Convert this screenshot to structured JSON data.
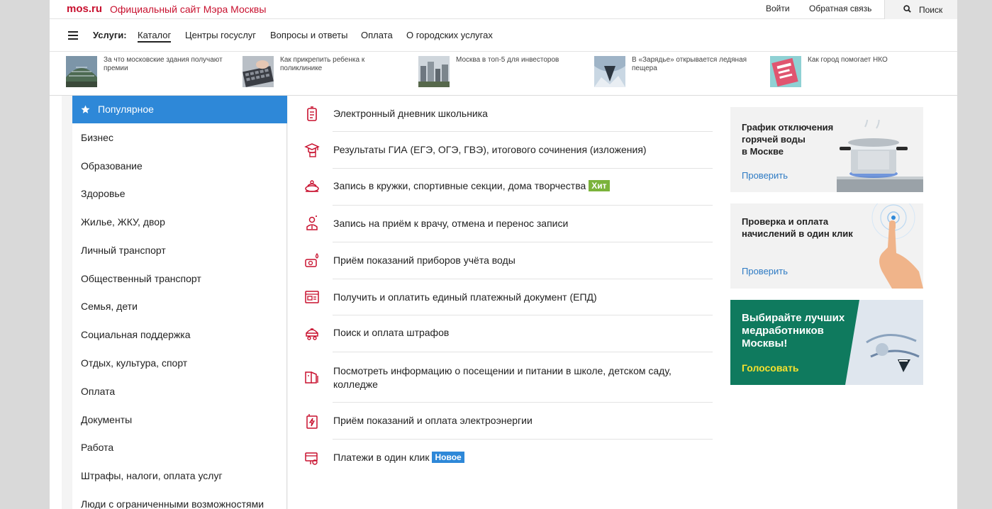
{
  "header": {
    "logo": "mos.ru",
    "site_title": "Официальный сайт Мэра Москвы",
    "login": "Войти",
    "feedback": "Обратная связь",
    "search": "Поиск"
  },
  "nav": {
    "label": "Услуги:",
    "items": [
      "Каталог",
      "Центры госуслуг",
      "Вопросы и ответы",
      "Оплата",
      "О городских услугах"
    ],
    "active": "Каталог"
  },
  "news": [
    {
      "line1": "За что московские здания получают",
      "line2": "премии"
    },
    {
      "line1": "Как прикрепить ребенка к",
      "line2": "поликлинике"
    },
    {
      "line1": "Москва в топ-5 для инвесторов",
      "line2": ""
    },
    {
      "line1": "В «Зарядье» открывается ледяная",
      "line2": "пещера"
    },
    {
      "line1": "Как город помогает НКО",
      "line2": ""
    }
  ],
  "sidebar": {
    "popular": "Популярное",
    "items": [
      "Бизнес",
      "Образование",
      "Здоровье",
      "Жилье, ЖКУ, двор",
      "Личный транспорт",
      "Общественный транспорт",
      "Семья, дети",
      "Социальная поддержка",
      "Отдых, культура, спорт",
      "Оплата",
      "Документы",
      "Работа",
      "Штрафы, налоги, оплата услуг",
      "Люди с ограниченными возможностями"
    ]
  },
  "services": [
    {
      "line1": "Электронный дневник школьника",
      "line2": "",
      "badge": "",
      "icon": "diary-icon"
    },
    {
      "line1": "Результаты ГИА (ЕГЭ, ОГЭ, ГВЭ), итогового сочинения (изложения)",
      "line2": "",
      "badge": "",
      "icon": "graduation-icon"
    },
    {
      "line1": "Запись в кружки, спортивные секции, дома творчества",
      "line2": "",
      "badge": "Хит",
      "icon": "clubs-icon"
    },
    {
      "line1": "Запись на приём к врачу, отмена и перенос записи",
      "line2": "",
      "badge": "",
      "icon": "doctor-icon"
    },
    {
      "line1": "Приём показаний приборов учёта воды",
      "line2": "",
      "badge": "",
      "icon": "water-meter-icon"
    },
    {
      "line1": "Получить и оплатить единый платежный документ (ЕПД)",
      "line2": "",
      "badge": "",
      "icon": "payment-document-icon"
    },
    {
      "line1": "Поиск и оплата штрафов",
      "line2": "",
      "badge": "",
      "icon": "fines-icon"
    },
    {
      "line1": "Посмотреть информацию о посещении и питании в школе, детском саду,",
      "line2": "колледже",
      "badge": "",
      "icon": "school-meal-icon"
    },
    {
      "line1": "Приём показаний и оплата электроэнергии",
      "line2": "",
      "badge": "",
      "icon": "electricity-icon"
    },
    {
      "line1": "Платежи в один клик",
      "line2": "",
      "badge": "Новое",
      "icon": "one-click-payment-icon"
    }
  ],
  "promos": [
    {
      "title": [
        "График отключения",
        "горячей воды",
        "в Москве"
      ],
      "link": "Проверить"
    },
    {
      "title": [
        "Проверка и оплата",
        "начислений в один клик"
      ],
      "link": "Проверить"
    },
    {
      "title": [
        "Выбирайте лучших",
        "медработников",
        "Москвы!"
      ],
      "link": "Голосовать"
    }
  ],
  "colors": {
    "brand": "#c8102e",
    "accent": "#2e88d8",
    "hit": "#7bb33b",
    "vote": "#0f7a5e"
  }
}
